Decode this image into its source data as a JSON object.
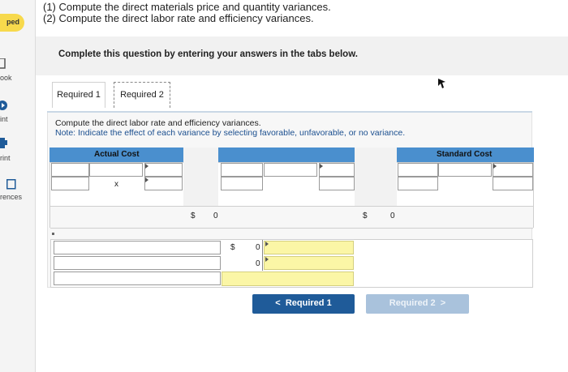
{
  "sidebar": {
    "pill_label": "ped",
    "items": [
      {
        "label": "ook",
        "icon": "book-icon"
      },
      {
        "label": "int",
        "icon": "hint-icon"
      },
      {
        "label": "rint",
        "icon": "print-icon"
      },
      {
        "label": "rences",
        "icon": "references-icon"
      }
    ]
  },
  "question": {
    "line1": "(1) Compute the direct materials price and quantity variances.",
    "line2": "(2) Compute the direct labor rate and efficiency variances."
  },
  "instructions": "Complete this question by entering your answers in the tabs below.",
  "tabs": [
    {
      "label": "Required 1",
      "active": false
    },
    {
      "label": "Required 2",
      "active": true
    }
  ],
  "panel": {
    "instruction": "Compute the direct labor rate and efficiency variances.",
    "note": "Note: Indicate the effect of each variance by selecting favorable, unfavorable, or no variance."
  },
  "table": {
    "header_actual": "Actual Cost",
    "header_standard": "Standard Cost",
    "times_symbol": "x",
    "dollar": "$",
    "actual_total": "0",
    "standard_total": "0",
    "variance_values": [
      "0",
      "0"
    ]
  },
  "buttons": {
    "prev_label": "Required 1",
    "next_label": "Required 2",
    "prev_chevron": "<",
    "next_chevron": ">"
  },
  "colors": {
    "header_blue": "#4a8fce",
    "button_blue": "#1f5b99",
    "button_disabled": "#a9c2dc",
    "pill_yellow": "#f7d94c",
    "input_yellow": "#fbf6a6"
  }
}
